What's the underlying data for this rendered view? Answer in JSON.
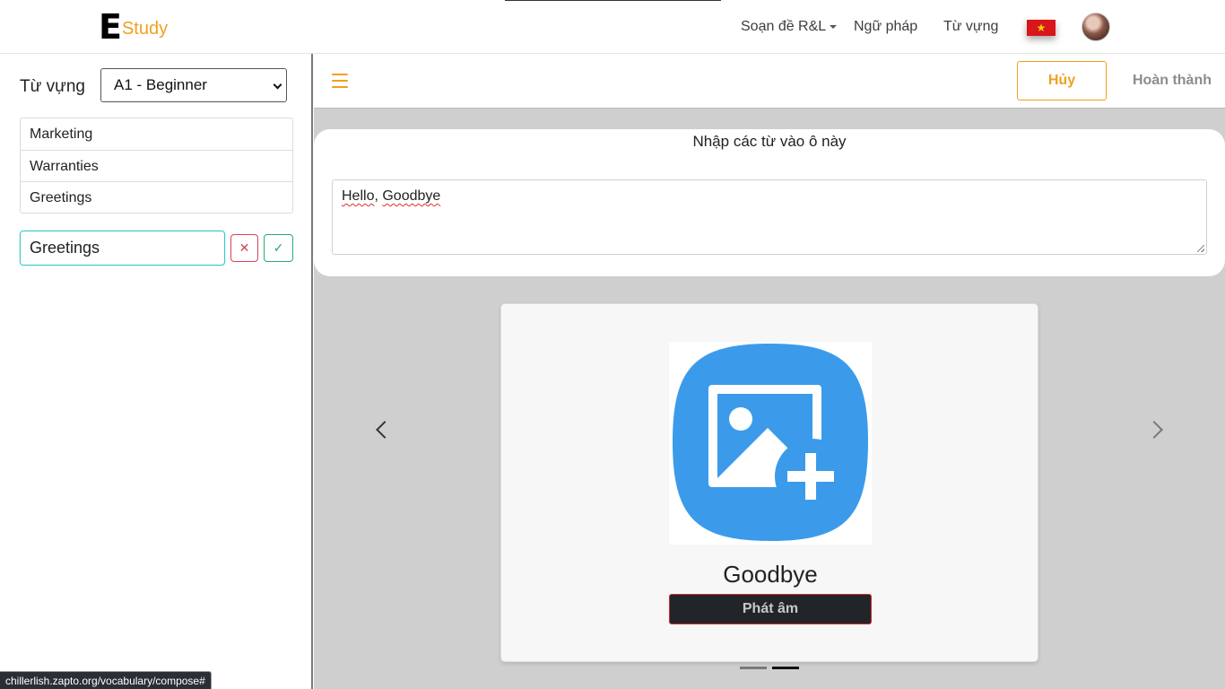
{
  "app": {
    "logo_letter": "E",
    "logo_text": "Study",
    "brand_color": "#f0a020"
  },
  "nav": {
    "items": [
      {
        "label": "Soạn đề R&L",
        "dropdown": true
      },
      {
        "label": "Ngữ pháp"
      },
      {
        "label": "Từ vựng"
      }
    ],
    "flag_icon": "vietnam-flag-icon",
    "flag_star": "★"
  },
  "sidebar": {
    "label": "Từ vựng",
    "level_select": {
      "selected": "A1 - Beginner"
    },
    "topics": [
      "Marketing",
      "Warranties",
      "Greetings"
    ],
    "new_topic_value": "Greetings",
    "cancel_symbol": "✕",
    "confirm_symbol": "✓"
  },
  "toolbar": {
    "cancel_label": "Hủy",
    "done_label": "Hoàn thành"
  },
  "input": {
    "title": "Nhập các từ vào ô này",
    "words": [
      "Hello",
      "Goodbye"
    ],
    "separator": ", "
  },
  "card": {
    "image_icon": "add-image-icon",
    "word": "Goodbye",
    "pronounce_label": "Phát âm"
  },
  "carousel": {
    "slides": 2,
    "active_slide": 2
  },
  "status": {
    "url": "chillerlish.zapto.org/vocabulary/compose#"
  }
}
